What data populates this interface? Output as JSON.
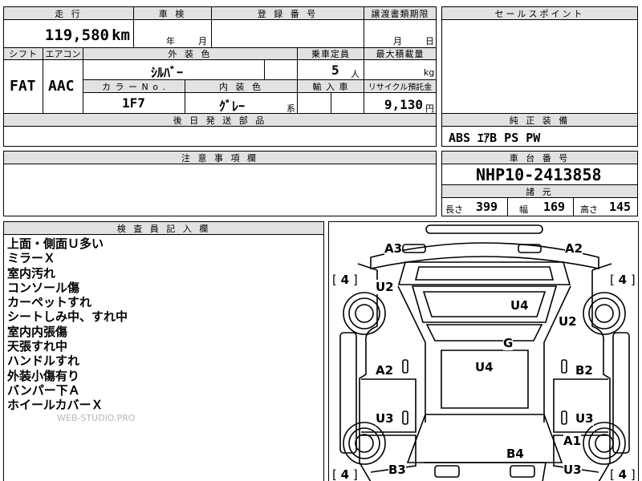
{
  "top_form": {
    "mileage_header": "走 行",
    "mileage_value": "119,580",
    "mileage_unit": "km",
    "inspection_header": "車 検",
    "inspection_year": "年",
    "inspection_month": "月",
    "registration_header": "登 録 番 号",
    "transfer_header": "譲渡書類期限",
    "transfer_month": "月",
    "transfer_day": "日",
    "shift_header": "シフト",
    "shift_value": "FAT",
    "ac_header": "エアコン",
    "ac_value": "AAC",
    "exterior_color_header": "外 装 色",
    "exterior_color_value": "ｼﾙﾊﾞｰ",
    "capacity_header": "乗車定員",
    "capacity_value": "5",
    "capacity_unit": "人",
    "max_load_header": "最大積載量",
    "max_load_unit": "kg",
    "color_no_header": "カ ラ ー N o .",
    "color_no_value": "1F7",
    "interior_color_header": "内 装 色",
    "interior_color_value": "ｸﾞﾚｰ",
    "interior_color_suffix": "系",
    "import_header": "輸 入 車",
    "recycle_header": "リサイクル預託金",
    "recycle_value": "9,130",
    "recycle_unit": "円",
    "later_parts_header": "後 日 発 送 部 品"
  },
  "sales_point": {
    "header": "セールスポイント"
  },
  "equipment": {
    "header": "純 正 装 備",
    "value": "ABS ｴｱB PS PW"
  },
  "caution": {
    "header": "注 意 事 項 欄"
  },
  "chassis": {
    "header": "車 台 番 号",
    "value": "NHP10-2413858"
  },
  "specs": {
    "header": "諸 元",
    "length_label": "長さ",
    "length_value": "399",
    "width_label": "幅",
    "width_value": "169",
    "height_label": "高さ",
    "height_value": "145"
  },
  "inspector": {
    "header": "検 査 員 記 入 欄",
    "notes": [
      "上面・側面Ｕ多い",
      "ミラーＸ",
      "室内汚れ",
      "コンソール傷",
      "カーペットすれ",
      "シートしみ中、すれ中",
      "室内内張傷",
      "天張すれ中",
      "ハンドルすれ",
      "外装小傷有り",
      "バンパー下Ａ",
      "ホイールカバーＸ"
    ],
    "watermark": "WEB-STUDIO.PRO"
  },
  "diagram": {
    "tire_tl": "4",
    "tire_tr": "4",
    "tire_bl": "4",
    "tire_br": "4",
    "marks": [
      {
        "id": "a3",
        "text": "A3"
      },
      {
        "id": "a2-top",
        "text": "A2"
      },
      {
        "id": "u2-left",
        "text": "U2"
      },
      {
        "id": "u4-top",
        "text": "U4"
      },
      {
        "id": "u2-right",
        "text": "U2"
      },
      {
        "id": "g",
        "text": "G"
      },
      {
        "id": "a2-left",
        "text": "A2"
      },
      {
        "id": "u4-center",
        "text": "U4"
      },
      {
        "id": "b2",
        "text": "B2"
      },
      {
        "id": "u3-left",
        "text": "U3"
      },
      {
        "id": "u3-right",
        "text": "U3"
      },
      {
        "id": "a1",
        "text": "A1"
      },
      {
        "id": "b4",
        "text": "B4"
      },
      {
        "id": "b3",
        "text": "B3"
      },
      {
        "id": "u3-bottom",
        "text": "U3"
      }
    ]
  }
}
